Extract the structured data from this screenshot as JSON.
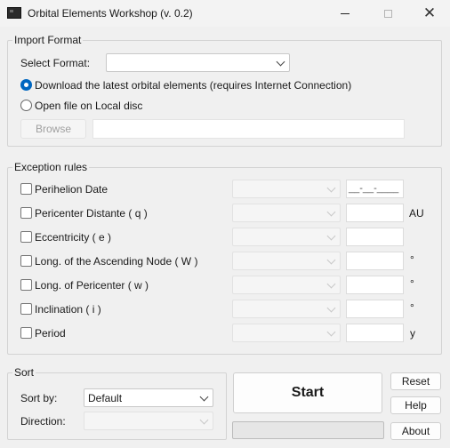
{
  "window": {
    "title": "Orbital Elements Workshop (v. 0.2)",
    "minimize_icon": "minimize-icon",
    "maximize_icon": "maximize-icon",
    "close_icon": "close-icon",
    "close_glyph": "✕"
  },
  "import_format": {
    "title": "Import Format",
    "select_label": "Select Format:",
    "select_value": "",
    "radio_download": "Download the latest orbital elements (requires Internet Connection)",
    "radio_download_checked": true,
    "radio_local": "Open file on Local disc",
    "radio_local_checked": false,
    "browse_label": "Browse",
    "path_value": ""
  },
  "exception_rules": {
    "title": "Exception rules",
    "rows": [
      {
        "label": "Perihelion Date",
        "combo_value": "",
        "field_value": "__-__-____",
        "unit": ""
      },
      {
        "label": "Pericenter Distante ( q )",
        "combo_value": "",
        "field_value": "",
        "unit": "AU"
      },
      {
        "label": "Eccentricity ( e )",
        "combo_value": "",
        "field_value": "",
        "unit": ""
      },
      {
        "label": "Long. of the Ascending Node ( W )",
        "combo_value": "",
        "field_value": "",
        "unit": "°"
      },
      {
        "label": "Long. of Pericenter ( w )",
        "combo_value": "",
        "field_value": "",
        "unit": "°"
      },
      {
        "label": "Inclination ( i )",
        "combo_value": "",
        "field_value": "",
        "unit": "°"
      },
      {
        "label": "Period",
        "combo_value": "",
        "field_value": "",
        "unit": "y"
      }
    ]
  },
  "sort": {
    "title": "Sort",
    "sort_by_label": "Sort by:",
    "sort_by_value": "Default",
    "direction_label": "Direction:",
    "direction_value": ""
  },
  "actions": {
    "start": "Start",
    "reset": "Reset",
    "help": "Help",
    "about": "About",
    "progress_percent": 0
  },
  "colors": {
    "accent": "#0067c0",
    "background": "#f0f0f0"
  }
}
